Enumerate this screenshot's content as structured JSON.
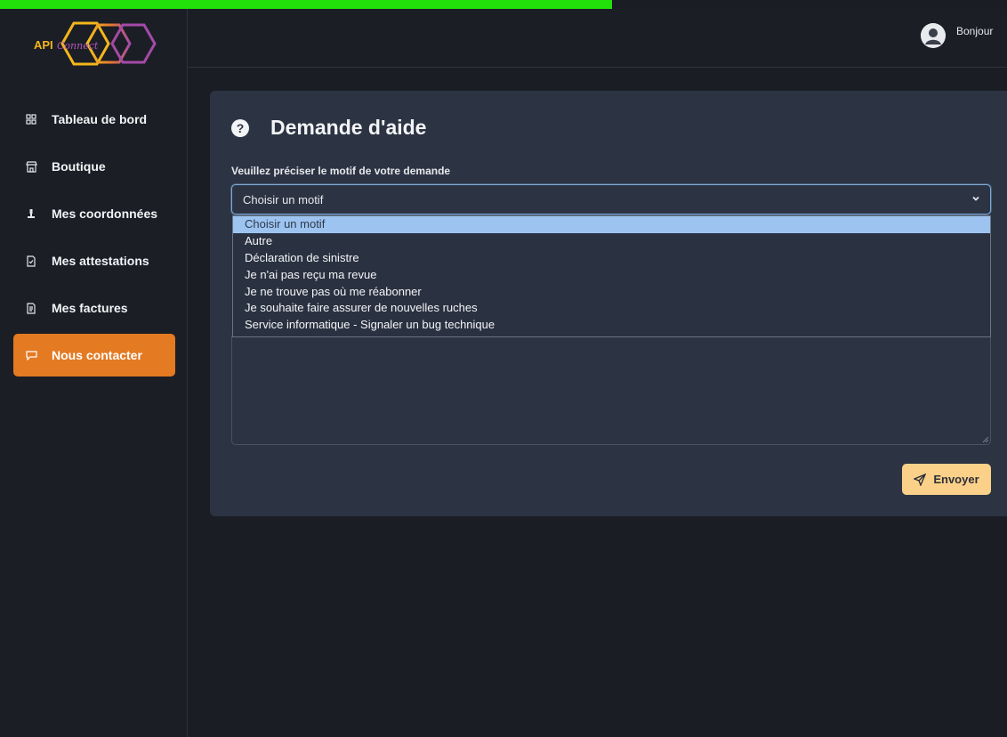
{
  "brand": {
    "logo_text_main": "API",
    "logo_text_script": "Connect"
  },
  "sidebar": {
    "items": [
      {
        "label": "Tableau de bord",
        "icon": "dashboard-icon",
        "active": false
      },
      {
        "label": "Boutique",
        "icon": "store-icon",
        "active": false
      },
      {
        "label": "Mes coordonnées",
        "icon": "user-icon",
        "active": false
      },
      {
        "label": "Mes attestations",
        "icon": "document-icon",
        "active": false
      },
      {
        "label": "Mes factures",
        "icon": "invoice-icon",
        "active": false
      },
      {
        "label": "Nous contacter",
        "icon": "chat-icon",
        "active": true
      }
    ]
  },
  "header": {
    "greeting": "Bonjour",
    "avatar_icon": "user-avatar-icon"
  },
  "form": {
    "title": "Demande d'aide",
    "title_icon": "question-circle-icon",
    "motif_label": "Veuillez préciser le motif de votre demande",
    "select_value": "Choisir un motif",
    "options": [
      "Choisir un motif",
      "Autre",
      "Déclaration de sinistre",
      "Je n'ai pas reçu ma revue",
      "Je ne trouve pas où me réabonner",
      "Je souhaite faire assurer de nouvelles ruches",
      "Service informatique - Signaler un bug technique"
    ],
    "selected_option_index": 0,
    "send_label": "Envoyer"
  },
  "colors": {
    "accent_orange": "#e47a22",
    "button_yellow": "#fbd089",
    "panel": "#2c3443",
    "background": "#1b1d24",
    "top_strip_green": "#22e10b"
  }
}
